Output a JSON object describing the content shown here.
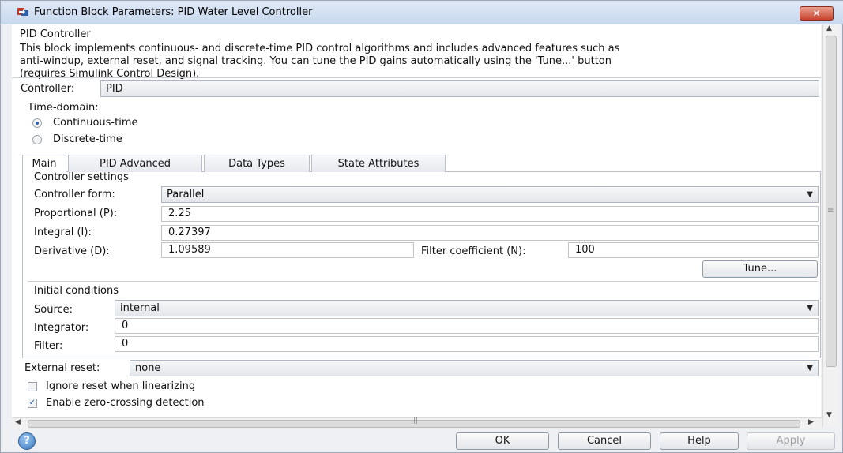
{
  "window": {
    "title": "Function Block Parameters: PID Water Level Controller",
    "close_label": "✕"
  },
  "block": {
    "name": "PID Controller",
    "description": [
      "This block implements continuous- and discrete-time PID control algorithms and includes advanced features such as",
      "anti-windup, external reset, and signal tracking. You can tune the PID gains automatically using the 'Tune...' button",
      "(requires Simulink Control Design)."
    ]
  },
  "controller": {
    "label": "Controller:",
    "value": "PID"
  },
  "time_domain": {
    "label": "Time-domain:",
    "options": [
      {
        "label": "Continuous-time",
        "selected": true
      },
      {
        "label": "Discrete-time",
        "selected": false
      }
    ]
  },
  "tabs": [
    {
      "label": "Main",
      "active": true
    },
    {
      "label": "PID Advanced",
      "active": false
    },
    {
      "label": "Data Types",
      "active": false
    },
    {
      "label": "State Attributes",
      "active": false
    }
  ],
  "controller_settings": {
    "title": "Controller settings",
    "form_label": "Controller form:",
    "form_value": "Parallel",
    "p_label": "Proportional (P):",
    "p_value": "2.25",
    "i_label": "Integral (I):",
    "i_value": "0.27397",
    "d_label": "Derivative (D):",
    "d_value": "1.09589",
    "n_label": "Filter coefficient (N):",
    "n_value": "100",
    "tune_label": "Tune..."
  },
  "initial_conditions": {
    "title": "Initial conditions",
    "source_label": "Source:",
    "source_value": "internal",
    "integrator_label": "Integrator:",
    "integrator_value": "0",
    "filter_label": "Filter:",
    "filter_value": "0"
  },
  "external_reset": {
    "label": "External reset:",
    "value": "none"
  },
  "checkboxes": [
    {
      "label": "Ignore reset when linearizing",
      "checked": false
    },
    {
      "label": "Enable zero-crossing detection",
      "checked": true
    }
  ],
  "buttons": {
    "ok": "OK",
    "cancel": "Cancel",
    "help": "Help",
    "apply": "Apply"
  },
  "icons": {
    "help": "help-icon",
    "app": "simulink-block-icon",
    "dropdown": "chevron-down-icon"
  },
  "colors": {
    "title_bar": "#c9d8ee",
    "close_button": "#c8432c",
    "radio_selected": "#2a64b4"
  }
}
